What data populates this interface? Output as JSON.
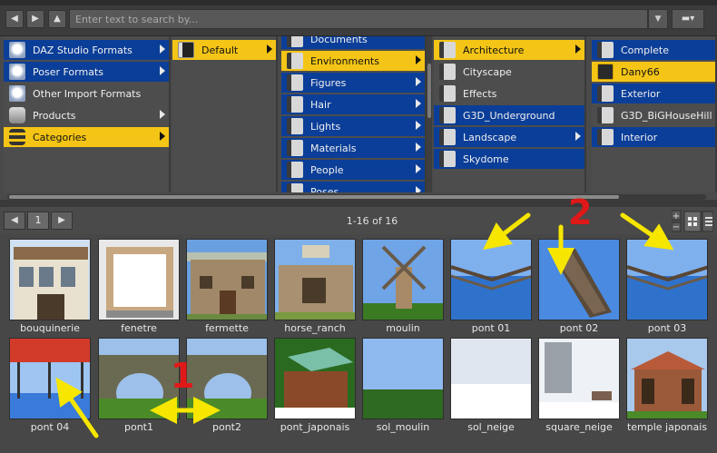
{
  "search": {
    "placeholder": "Enter text to search by..."
  },
  "columns": {
    "sources": [
      {
        "label": "DAZ Studio Formats",
        "state": "blue",
        "icon": "cube-icon",
        "arrow": true
      },
      {
        "label": "Poser Formats",
        "state": "blue",
        "icon": "cube-icon",
        "arrow": true
      },
      {
        "label": "Other Import Formats",
        "state": "none",
        "icon": "cube-icon",
        "arrow": false
      },
      {
        "label": "Products",
        "state": "none",
        "icon": "database-icon",
        "arrow": true
      },
      {
        "label": "Categories",
        "state": "sel",
        "icon": "database-icon",
        "arrow": true
      }
    ],
    "col2": [
      {
        "label": "Default",
        "state": "sel",
        "icon": "folder-dark-icon",
        "arrow": true
      }
    ],
    "col3": [
      {
        "label": "Documents",
        "state": "blue",
        "arrow": false
      },
      {
        "label": "Environments",
        "state": "sel",
        "arrow": true
      },
      {
        "label": "Figures",
        "state": "blue",
        "arrow": true
      },
      {
        "label": "Hair",
        "state": "blue",
        "arrow": true
      },
      {
        "label": "Lights",
        "state": "blue",
        "arrow": true
      },
      {
        "label": "Materials",
        "state": "blue",
        "arrow": true
      },
      {
        "label": "People",
        "state": "blue",
        "arrow": true
      },
      {
        "label": "Poses",
        "state": "blue",
        "arrow": true
      }
    ],
    "col4": [
      {
        "label": "Architecture",
        "state": "sel",
        "arrow": true
      },
      {
        "label": "Cityscape",
        "state": "none",
        "arrow": false
      },
      {
        "label": "Effects",
        "state": "none",
        "arrow": false
      },
      {
        "label": "G3D_Underground",
        "state": "blue",
        "arrow": false
      },
      {
        "label": "Landscape",
        "state": "blue",
        "arrow": true
      },
      {
        "label": "Skydome",
        "state": "blue",
        "arrow": false
      }
    ],
    "col5": [
      {
        "label": "Complete",
        "state": "blue"
      },
      {
        "label": "Dany66",
        "state": "sel"
      },
      {
        "label": "Exterior",
        "state": "blue"
      },
      {
        "label": "G3D_BiGHouseHill",
        "state": "none"
      },
      {
        "label": "Interior",
        "state": "blue"
      }
    ]
  },
  "pager": {
    "page": "1",
    "count": "1-16 of 16"
  },
  "thumbnails": [
    {
      "name": "bouquinerie",
      "kind": "shop"
    },
    {
      "name": "fenetre",
      "kind": "window"
    },
    {
      "name": "fermette",
      "kind": "farm"
    },
    {
      "name": "horse_ranch",
      "kind": "ranch"
    },
    {
      "name": "moulin",
      "kind": "mill"
    },
    {
      "name": "pont 01",
      "kind": "bridge"
    },
    {
      "name": "pont 02",
      "kind": "bridge2"
    },
    {
      "name": "pont 03",
      "kind": "bridge"
    },
    {
      "name": "pont 04",
      "kind": "pier"
    },
    {
      "name": "pont1",
      "kind": "arch"
    },
    {
      "name": "pont2",
      "kind": "arch"
    },
    {
      "name": "pont_japonais",
      "kind": "japan"
    },
    {
      "name": "sol_moulin",
      "kind": "field"
    },
    {
      "name": "sol_neige",
      "kind": "snowfield"
    },
    {
      "name": "square_neige",
      "kind": "snowsquare"
    },
    {
      "name": "temple japonais",
      "kind": "temple"
    }
  ],
  "annotations": {
    "label_1": "1",
    "label_2": "2"
  },
  "colors": {
    "selected": "#f4c516",
    "highlight": "#0b3e98",
    "annotation_arrow": "#f6e600",
    "annotation_number": "#e01818"
  }
}
